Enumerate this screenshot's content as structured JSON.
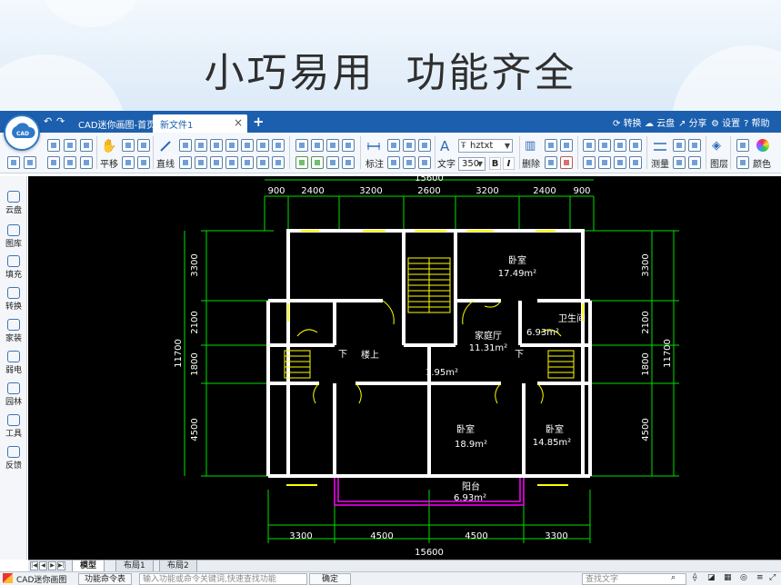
{
  "banner": {
    "headline": "小巧易用  功能齐全"
  },
  "titlebar": {
    "app_tab": "CAD迷你画图-首页",
    "doc_tab": "新文件1",
    "tab_close": "×",
    "tab_add": "+",
    "actions": [
      "转换",
      "云盘",
      "分享",
      "设置",
      "帮助"
    ]
  },
  "toolbar": {
    "pan": "平移",
    "line": "直线",
    "dimension": "标注",
    "text": "文字",
    "font": "hztxt",
    "font_size": "350",
    "bold": "B",
    "italic": "I",
    "delete": "删除",
    "measure": "测量",
    "layer": "图层",
    "color": "颜色"
  },
  "sidebar": {
    "items": [
      "云盘",
      "图库",
      "填充",
      "转换",
      "家装",
      "弱电",
      "园林",
      "工具",
      "反馈"
    ]
  },
  "drawing": {
    "top_dims": [
      "900",
      "2400",
      "3200",
      "2600",
      "3200",
      "2400",
      "900"
    ],
    "top_total": "15600",
    "bottom_dims": [
      "3300",
      "4500",
      "4500",
      "3300"
    ],
    "bottom_total": "15600",
    "left_dims": [
      "3300",
      "2100",
      "1800",
      "4500"
    ],
    "left_total": "11700",
    "right_dims": [
      "3300",
      "2100",
      "1800",
      "4500"
    ],
    "right_total": "11700",
    "rooms": [
      {
        "name": "卧室",
        "area": "17.49m²"
      },
      {
        "name": "卫生间",
        "area": "6.93m²"
      },
      {
        "name": "家庭厅",
        "area": "11.31m²"
      },
      {
        "name": "楼上",
        "area": ""
      },
      {
        "name": "",
        "area": "1.95m²"
      },
      {
        "name": "卧室",
        "area": "18.9m²"
      },
      {
        "name": "卧室",
        "area": "14.85m²"
      },
      {
        "name": "阳台",
        "area": "6.93m²"
      }
    ],
    "down_mark": "下"
  },
  "layout_tabs": [
    "模型",
    "布局1",
    "布局2"
  ],
  "nav_buttons": [
    "|◀",
    "◀",
    "▶",
    "▶|"
  ],
  "status": {
    "app": "CAD迷你画图",
    "command_table": "功能命令表",
    "command_placeholder": "输入功能或命令关键词,快速查找功能",
    "confirm": "确定",
    "search_placeholder": "查找文字"
  },
  "colors": {
    "titlebar": "#1b5fae",
    "wall": "#ffffff",
    "dim": "#00ff00",
    "door": "#ffff00",
    "balcony": "#ff00ff"
  }
}
